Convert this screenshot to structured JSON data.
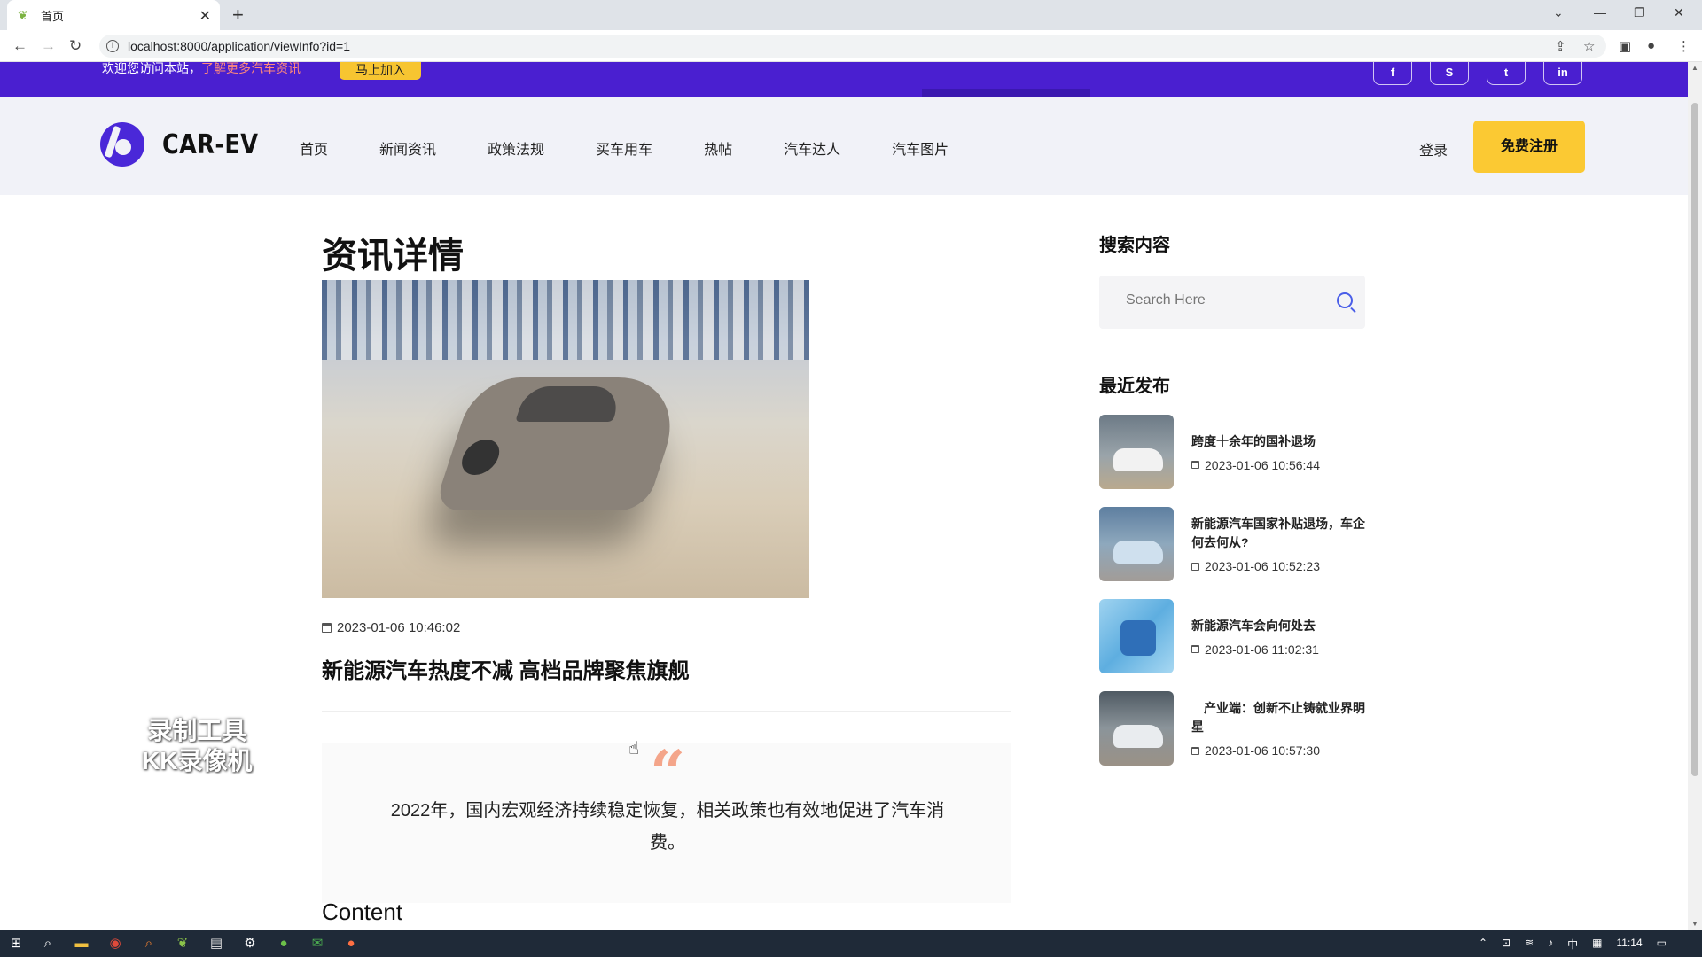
{
  "browser": {
    "tab_title": "首页",
    "url": "localhost:8000/application/viewInfo?id=1"
  },
  "topbar": {
    "welcome": "欢迎您访问本站，",
    "highlight": "了解更多汽车资讯",
    "join": "马上加入",
    "social": [
      "f",
      "S",
      "t",
      "in"
    ]
  },
  "header": {
    "logo": "CAR-EV",
    "menu": [
      "首页",
      "新闻资讯",
      "政策法规",
      "买车用车",
      "热帖",
      "汽车达人",
      "汽车图片"
    ],
    "login": "登录",
    "register": "免费注册"
  },
  "main": {
    "heading": "资讯详情",
    "date": "2023-01-06 10:46:02",
    "title": "新能源汽车热度不减 高档品牌聚焦旗舰",
    "quote": "2022年，国内宏观经济持续稳定恢复，相关政策也有效地促进了汽车消费。",
    "content_heading": "Content"
  },
  "sidebar": {
    "search_heading": "搜索内容",
    "search_placeholder": "Search Here",
    "recent_heading": "最近发布",
    "recent": [
      {
        "title": "跨度十余年的国补退场",
        "date": "2023-01-06 10:56:44"
      },
      {
        "title": "新能源汽车国家补贴退场，车企何去何从?",
        "date": "2023-01-06 10:52:23"
      },
      {
        "title": "新能源汽车会向何处去",
        "date": "2023-01-06 11:02:31"
      },
      {
        "title": "　产业端：创新不止铸就业界明星",
        "date": "2023-01-06 10:57:30"
      }
    ]
  },
  "watermark": [
    "录制工具",
    "KK录像机"
  ],
  "taskbar": {
    "ime": "中",
    "time": "11:14"
  },
  "colors": {
    "accent_purple": "#4a1fd0",
    "accent_yellow": "#fbc933",
    "quote_mark": "#f4a58a"
  }
}
